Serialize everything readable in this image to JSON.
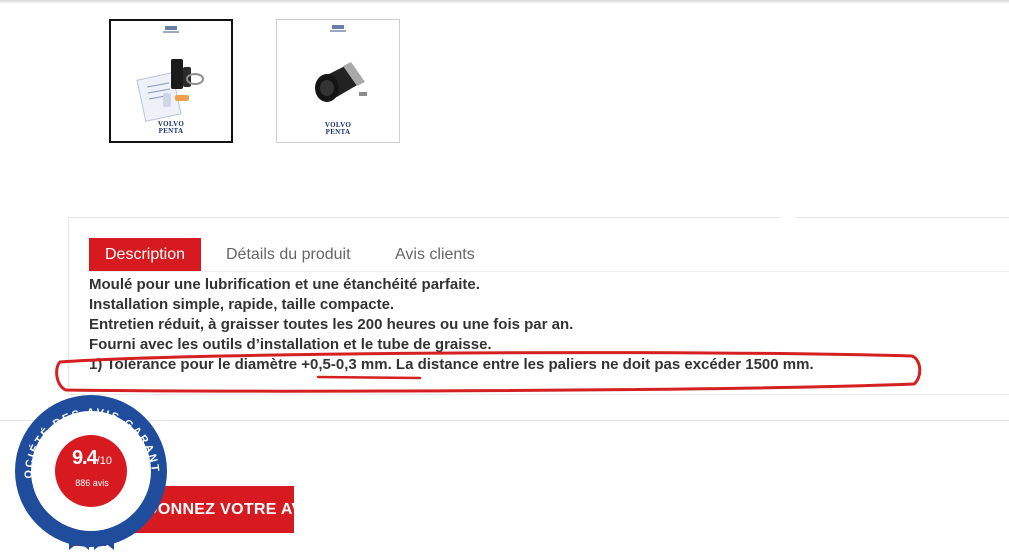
{
  "gallery": {
    "thumbnails": [
      {
        "brand": "VOLVO PENTA",
        "alt": "kit"
      },
      {
        "brand": "VOLVO PENTA",
        "alt": "bearing"
      }
    ]
  },
  "tabs": [
    {
      "label": "Description",
      "active": true
    },
    {
      "label": "Détails du produit",
      "active": false
    },
    {
      "label": "Avis clients",
      "active": false
    }
  ],
  "description": {
    "lines": [
      "Moulé pour une lubrification et une étanchéité parfaite.",
      "Installation simple, rapide, taille compacte.",
      "Entretien réduit, à graisser toutes les 200 heures ou une fois par an.",
      "Fourni avec les outils d’installation et le tube de graisse.",
      "1) Tolérance pour le diamètre +0,5-0,3 mm. La distance entre les paliers ne doit pas excéder 1500 mm."
    ]
  },
  "review_button": {
    "label": "DONNEZ VOTRE AVIS"
  },
  "badge": {
    "ring_text": "SOCIÉTÉ DES AVIS GARANTIS",
    "score": "9.4",
    "scale": "/10",
    "count": "886 avis"
  },
  "colors": {
    "accent": "#d71920",
    "badge_blue": "#1f4d9c",
    "annotation": "#d42020"
  }
}
